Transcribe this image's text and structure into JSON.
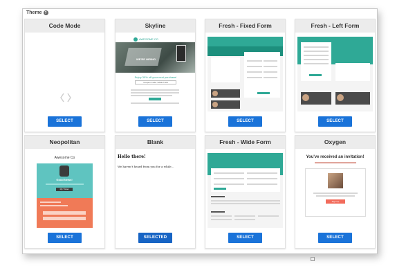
{
  "panel": {
    "title": "Theme",
    "help_icon": "question-circle-icon"
  },
  "themes": [
    {
      "name": "Code Mode",
      "button": "SELECT"
    },
    {
      "name": "Skyline",
      "button": "SELECT",
      "preview": {
        "brand": "AWESOME CO",
        "headline": "WE'RE HIRING",
        "offer": "Enjoy 30% off your next purchase!",
        "cta": "Coupon Code: SAVE THIS"
      }
    },
    {
      "name": "Fresh - Fixed Form",
      "button": "SELECT"
    },
    {
      "name": "Fresh - Left Form",
      "button": "SELECT"
    },
    {
      "name": "Neopolitan",
      "button": "SELECT",
      "preview": {
        "brand": "Awesome Co",
        "headline": "Good News!",
        "cta": "My Ticket"
      }
    },
    {
      "name": "Blank",
      "button": "SELECTED",
      "preview": {
        "heading": "Hello there!",
        "body": "We haven't heard from you for a while..."
      }
    },
    {
      "name": "Fresh - Wide Form",
      "button": "SELECT"
    },
    {
      "name": "Oxygen",
      "button": "SELECT",
      "preview": {
        "heading": "You've received an invitation!",
        "cta": "Sign Up"
      }
    }
  ],
  "colors": {
    "accent": "#1a73d9",
    "teal": "#2fa996",
    "neo_teal": "#5fc4c0",
    "neo_orange": "#f07a57",
    "oxygen_red": "#f26b5b"
  }
}
